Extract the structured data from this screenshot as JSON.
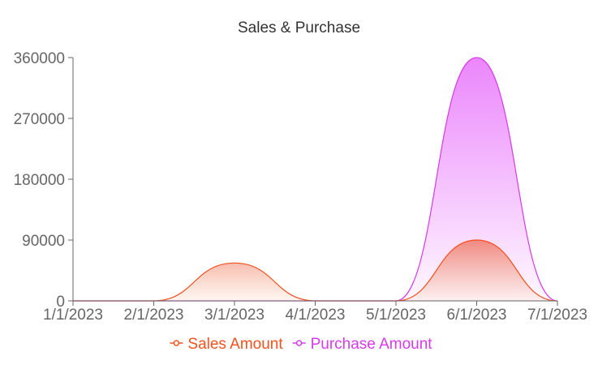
{
  "card": {
    "title": "Sales & Purchase"
  },
  "chart_data": {
    "type": "area",
    "title": "Sales & Purchase",
    "xlabel": "",
    "ylabel": "",
    "x": [
      "1/1/2023",
      "2/1/2023",
      "3/1/2023",
      "4/1/2023",
      "5/1/2023",
      "6/1/2023",
      "7/1/2023"
    ],
    "series": [
      {
        "name": "Sales Amount",
        "color": "#f4511e",
        "values": [
          0,
          0,
          56000,
          0,
          0,
          90000,
          0
        ]
      },
      {
        "name": "Purchase Amount",
        "color": "#d63aec",
        "values": [
          0,
          0,
          0,
          0,
          0,
          360000,
          0
        ]
      }
    ],
    "ylim": [
      0,
      360000
    ],
    "yticks": [
      "0",
      "90000",
      "180000",
      "270000",
      "360000"
    ],
    "grid": false,
    "legend": "bottom",
    "curve": "smooth"
  }
}
